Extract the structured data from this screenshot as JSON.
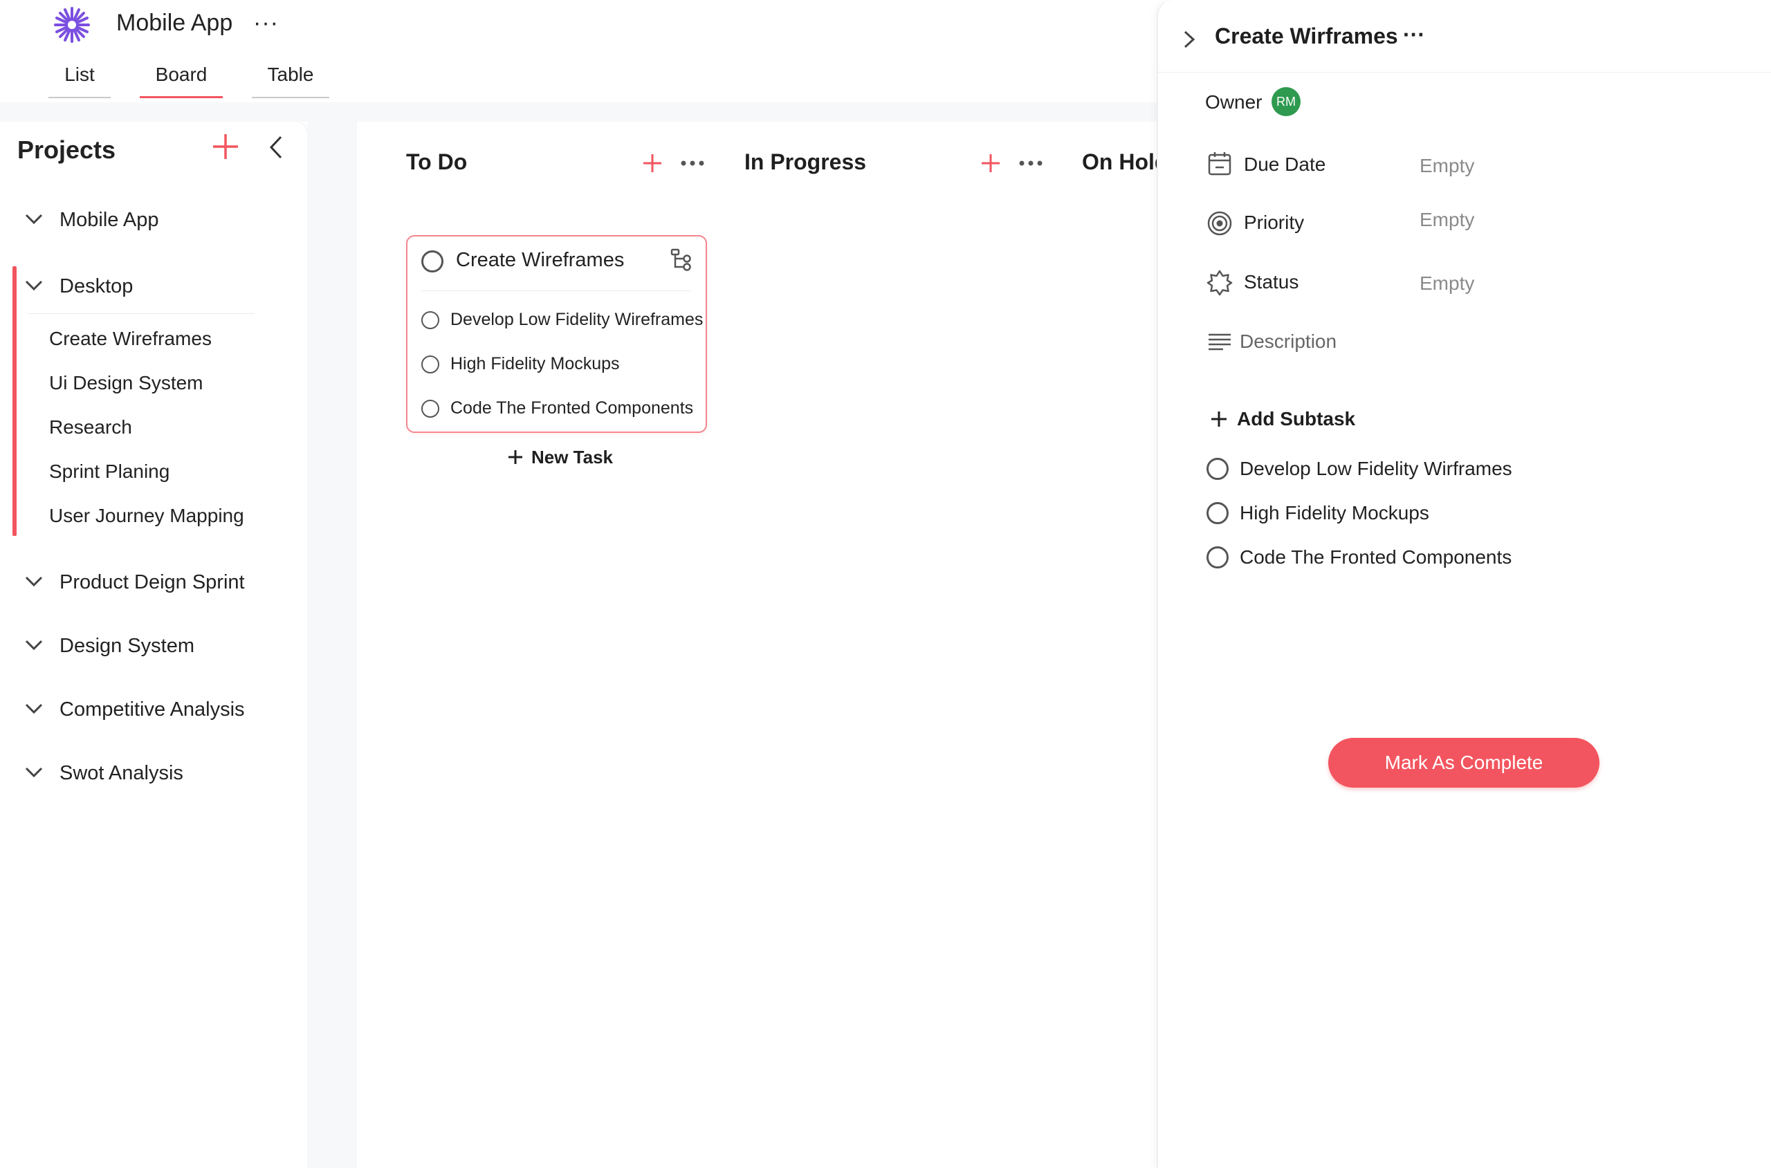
{
  "app": {
    "title": "Mobile App",
    "more": "···"
  },
  "tabs": [
    {
      "label": "List",
      "active": false
    },
    {
      "label": "Board",
      "active": true
    },
    {
      "label": "Table",
      "active": false
    }
  ],
  "sidebar": {
    "title": "Projects",
    "groups": [
      {
        "label": "Mobile App"
      },
      {
        "label": "Desktop",
        "active": true,
        "items": [
          "Create Wireframes",
          "Ui Design System",
          "Research",
          "Sprint Planing",
          "User Journey Mapping"
        ]
      },
      {
        "label": "Product Deign Sprint"
      },
      {
        "label": "Design System"
      },
      {
        "label": "Competitive Analysis"
      },
      {
        "label": "Swot Analysis"
      }
    ]
  },
  "board": {
    "columns": [
      {
        "title": "To Do"
      },
      {
        "title": "In Progress"
      },
      {
        "title": "On Hold"
      }
    ],
    "card": {
      "title": "Create Wireframes",
      "subtasks": [
        "Develop Low Fidelity Wireframes",
        "High Fidelity Mockups",
        "Code The Fronted Components"
      ]
    },
    "new_task": "New Task"
  },
  "panel": {
    "title": "Create Wirframes",
    "more": "···",
    "owner_label": "Owner",
    "owner_initials": "RM",
    "fields": [
      {
        "icon": "calendar-icon",
        "label": "Due Date",
        "value": "Empty"
      },
      {
        "icon": "target-icon",
        "label": "Priority",
        "value": "Empty"
      },
      {
        "icon": "badge-icon",
        "label": "Status",
        "value": "Empty"
      }
    ],
    "description_label": "Description",
    "add_subtask": "Add Subtask",
    "subtasks": [
      "Develop Low Fidelity Wirframes",
      "High Fidelity Mockups",
      "Code The Fronted Components"
    ],
    "complete_button": "Mark As Complete"
  },
  "colors": {
    "accent": "#f2555f",
    "logo": "#7b4fe0",
    "avatar": "#2e9a4f"
  }
}
